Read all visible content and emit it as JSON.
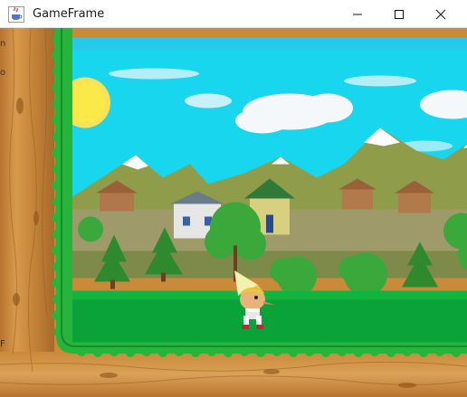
{
  "window": {
    "title": "GameFrame",
    "minimize_glyph": "—",
    "maximize_glyph": "☐",
    "close_glyph": "✕"
  },
  "game": {
    "character": "gnome-boy",
    "theme_colors": {
      "sky": "#18d6ee",
      "grass": "#0aa33a",
      "hedge": "#25b53a",
      "wood": "#c98a3a"
    }
  },
  "left_edge": {
    "glyph_top": "n",
    "glyph_mid": "o",
    "glyph_bottom": "F"
  }
}
